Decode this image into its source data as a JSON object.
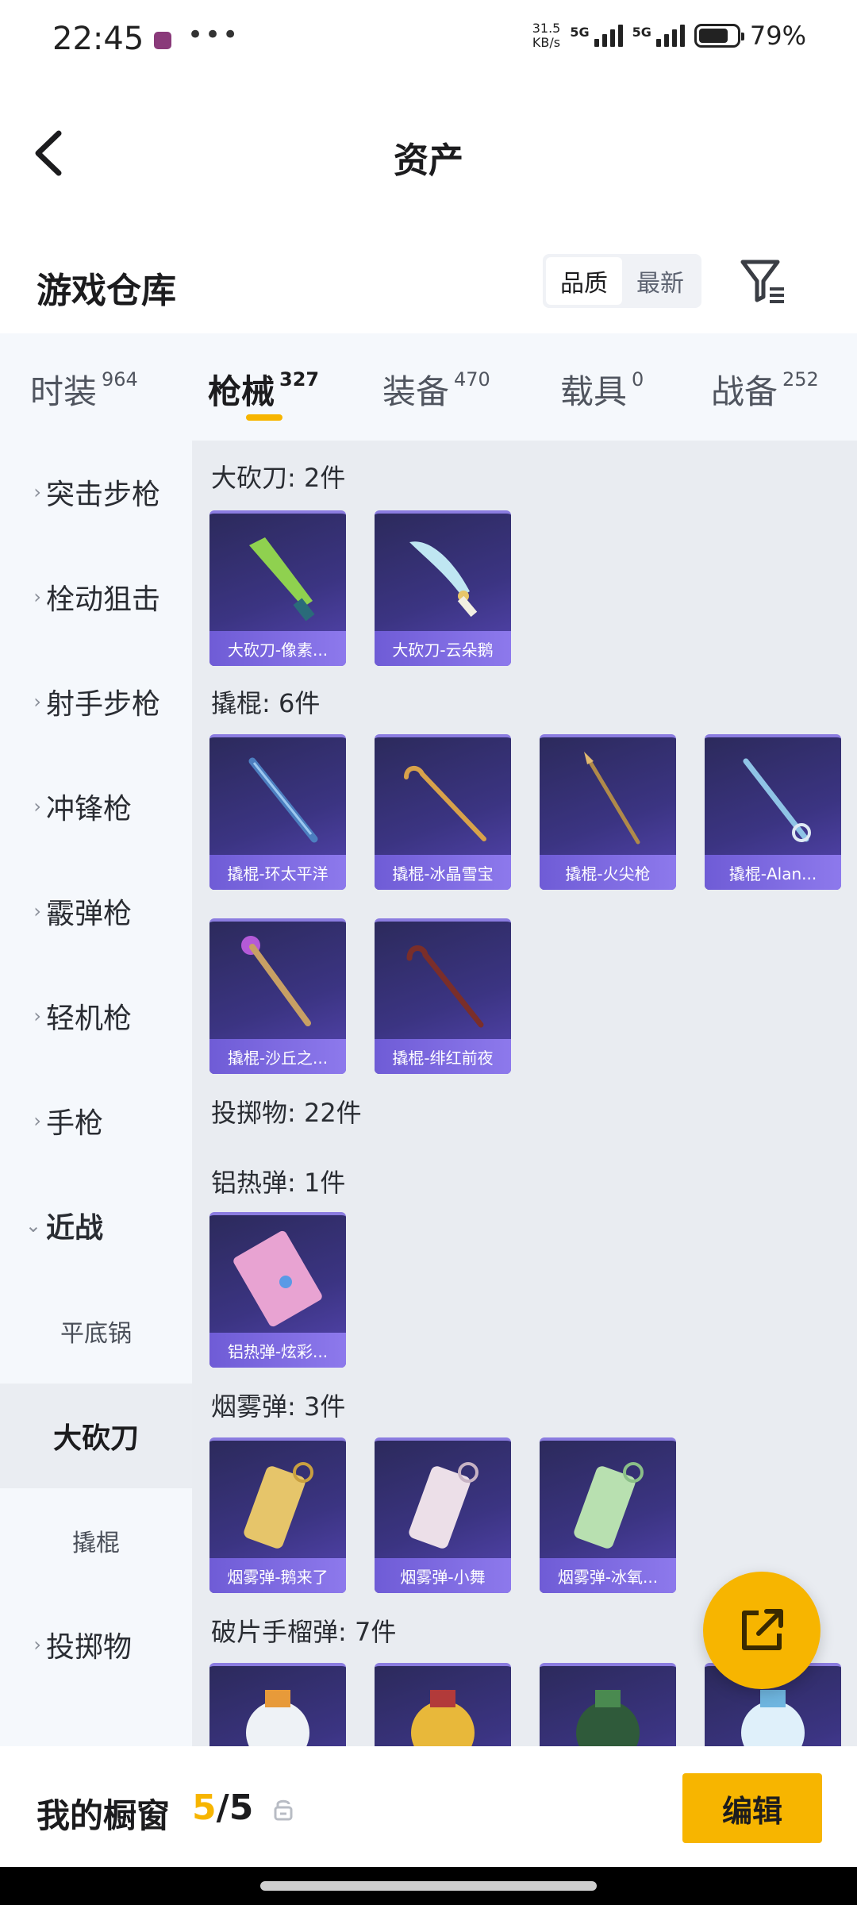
{
  "status_bar": {
    "time": "22:45",
    "speed_value": "31.5",
    "speed_unit": "KB/s",
    "net1": "5G",
    "net2": "5G",
    "battery_percent": "79%"
  },
  "nav": {
    "title": "资产"
  },
  "warehouse": {
    "title": "游戏仓库",
    "sort_options": [
      "品质",
      "最新"
    ],
    "sort_selected": "品质"
  },
  "tabs": [
    {
      "label": "时装",
      "count": "964",
      "active": false
    },
    {
      "label": "枪械",
      "count": "327",
      "active": true
    },
    {
      "label": "装备",
      "count": "470",
      "active": false
    },
    {
      "label": "载具",
      "count": "0",
      "active": false
    },
    {
      "label": "战备",
      "count": "252",
      "active": false
    }
  ],
  "sidebar": {
    "items": [
      {
        "label": "突击步枪"
      },
      {
        "label": "栓动狙击"
      },
      {
        "label": "射手步枪"
      },
      {
        "label": "冲锋枪"
      },
      {
        "label": "霰弹枪"
      },
      {
        "label": "轻机枪"
      },
      {
        "label": "手枪"
      },
      {
        "label": "近战"
      },
      {
        "label": "平底锅"
      },
      {
        "label": "大砍刀"
      },
      {
        "label": "撬棍"
      },
      {
        "label": "投掷物"
      }
    ]
  },
  "content": {
    "sections": [
      {
        "title": "大砍刀: 2件",
        "items": [
          "大砍刀-像素...",
          "大砍刀-云朵鹅"
        ]
      },
      {
        "title": "撬棍: 6件",
        "items": [
          "撬棍-环太平洋",
          "撬棍-冰晶雪宝",
          "撬棍-火尖枪",
          "撬棍-Alan...",
          "撬棍-沙丘之...",
          "撬棍-绯红前夜"
        ]
      },
      {
        "title": "投掷物: 22件",
        "items": []
      },
      {
        "title": "铝热弹: 1件",
        "items": [
          "铝热弹-炫彩..."
        ]
      },
      {
        "title": "烟雾弹: 3件",
        "items": [
          "烟雾弹-鹅来了",
          "烟雾弹-小舞",
          "烟雾弹-冰氧..."
        ]
      },
      {
        "title": "破片手榴弹: 7件",
        "items": []
      }
    ]
  },
  "bottom_bar": {
    "label": "我的橱窗",
    "count_current": "5",
    "count_sep": "/",
    "count_total": "5",
    "edit_label": "编辑"
  },
  "colors": {
    "accent": "#f7b500",
    "card_bg": "#3b3482"
  },
  "icons": [
    "back-chevron-icon",
    "filter-icon",
    "lock-icon",
    "share-export-icon",
    "chevron-right-icon",
    "chevron-down-icon"
  ]
}
